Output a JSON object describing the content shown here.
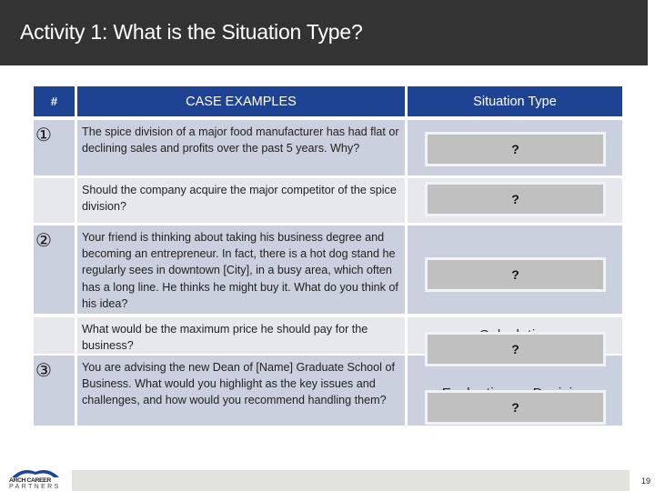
{
  "title": "Activity 1: What is the Situation Type?",
  "table": {
    "headers": {
      "number": "#",
      "case": "CASE EXAMPLES",
      "type": "Situation Type"
    },
    "rows": [
      {
        "number": "①",
        "case": "The spice division of a major food manufacturer has had flat or declining sales and profits over the past 5 years. Why?",
        "answer_hidden": "",
        "type_box": "?"
      },
      {
        "number": "",
        "case": "Should the company acquire the major competitor of the spice division?",
        "answer_hidden": "",
        "type_box": "?"
      },
      {
        "number": "②",
        "case": "Your friend is thinking about taking his business degree and becoming an entrepreneur. In fact, there is a hot dog stand he regularly sees in downtown [City], in a busy area, which often has a long line. He thinks he might buy it. What do you think of his idea?",
        "answer_hidden": "",
        "type_box": "?"
      },
      {
        "number": "",
        "case": "What would be the maximum price he should pay for the business?",
        "answer_hidden": "Calculation",
        "type_box": "?"
      },
      {
        "number": "③",
        "case": "You are advising the new Dean of [Name] Graduate School of Business. What would you highlight as the key issues and challenges, and how would you recommend handling them?",
        "answer_hidden": "Evaluation → Decision",
        "type_box": "?"
      }
    ]
  },
  "footer": {
    "logo_line1": "ARCH CAREER",
    "logo_line2": "PARTNERS",
    "page_number": "19"
  },
  "colors": {
    "title_bar": "#333333",
    "header_blue": "#1f4393",
    "row_dark": "#cbd0de",
    "row_light": "#e6e8ee",
    "answer_box": "#c0c0c0",
    "footer_bar": "#e3e3de"
  }
}
